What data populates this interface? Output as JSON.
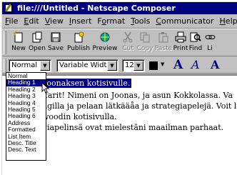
{
  "window": {
    "title": "file:///Untitled - Netscape Composer"
  },
  "menubar": [
    {
      "label": "File",
      "underline": "F"
    },
    {
      "label": "Edit",
      "underline": "E"
    },
    {
      "label": "View",
      "underline": "V"
    },
    {
      "label": "Insert",
      "underline": "I"
    },
    {
      "label": "Format",
      "underline": "o"
    },
    {
      "label": "Tools",
      "underline": "T"
    },
    {
      "label": "Communicator",
      "underline": "C"
    },
    {
      "label": "Help",
      "underline": "H"
    }
  ],
  "toolbar": {
    "new": "New",
    "open": "Open",
    "save": "Save",
    "publish": "Publish",
    "preview": "Preview",
    "cut": "Cut",
    "copy": "Copy",
    "paste": "Paste",
    "print": "Print",
    "find": "Find",
    "link": "Li"
  },
  "formatbar": {
    "paragraph_style": "Normal",
    "font": "Variable Width",
    "font_size": "12",
    "text_color": "#000000",
    "bigger_a": "A",
    "italic_a": "A",
    "serif_a": "A"
  },
  "style_list": {
    "items": [
      "Normal",
      "Heading 1",
      "Heading 2",
      "Heading 3",
      "Heading 4",
      "Heading 5",
      "Heading 6",
      "Address",
      "Formatted",
      "List Item",
      "Desc. Title",
      "Desc. Text"
    ],
    "selected_index": 1
  },
  "document": {
    "line1": "Joonaksen kotisivulle.",
    "line2": "ffarit! Nimeni on Joonas, ja asun Kokkolassa. Va",
    "line3": "ngilla ja pelaan lätkääåa ja strategiapelejä. Voit luk",
    "line4": "woodin kotisivulla.",
    "line5": "giapelinsä ovat mielestäni maailman parhaat.",
    "line2_prefix": "I",
    "line3_prefix": "n",
    "line4_prefix": "V",
    "line5_prefix": "I"
  },
  "colors": {
    "titlebar": "#000080",
    "selection": "#000080",
    "chrome": "#c0c0c0"
  }
}
